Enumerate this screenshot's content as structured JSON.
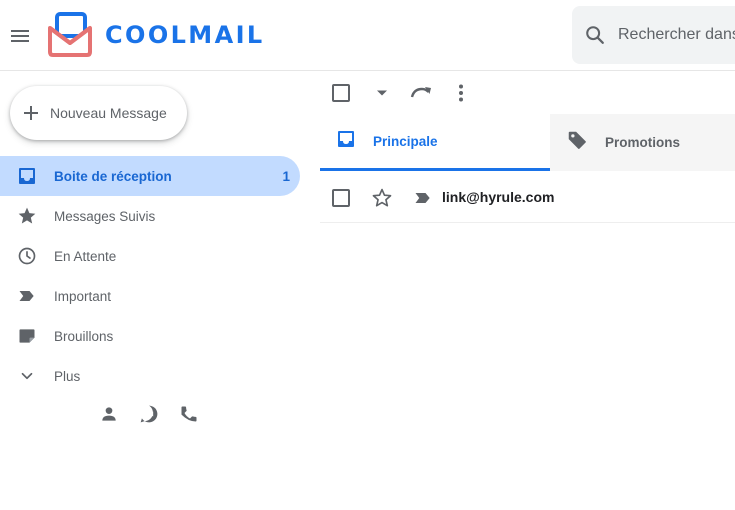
{
  "app": {
    "name": "COOLMAIL"
  },
  "search": {
    "placeholder": "Rechercher dans"
  },
  "compose": {
    "label": "Nouveau Message"
  },
  "sidebar": {
    "items": [
      {
        "label": "Boite de réception",
        "count": "1",
        "icon": "inbox-icon",
        "active": true
      },
      {
        "label": "Messages Suivis",
        "icon": "star-icon"
      },
      {
        "label": "En Attente",
        "icon": "clock-icon"
      },
      {
        "label": "Important",
        "icon": "important-icon"
      },
      {
        "label": "Brouillons",
        "icon": "draft-icon"
      },
      {
        "label": "Plus",
        "icon": "chevron-down-icon"
      }
    ]
  },
  "tabs": [
    {
      "label": "Principale",
      "icon": "inbox-icon",
      "active": true
    },
    {
      "label": "Promotions",
      "icon": "tag-icon"
    }
  ],
  "messages": [
    {
      "sender": "link@hyrule.com"
    }
  ],
  "colors": {
    "accent": "#1a73e8",
    "active_bg": "#c2dbff",
    "logo_red": "#e57373"
  }
}
